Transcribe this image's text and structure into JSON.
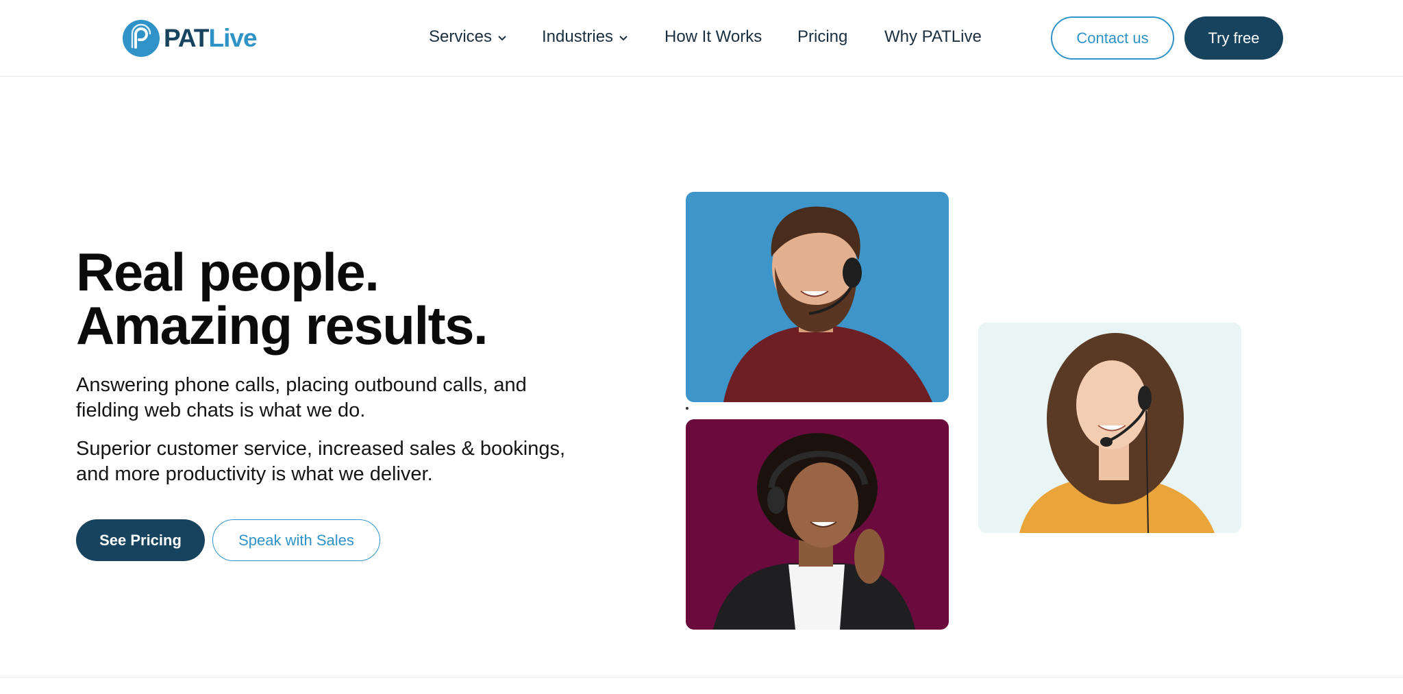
{
  "brand": {
    "logo_part1": "PAT",
    "logo_part2": "Live",
    "primary_color": "#17435e",
    "accent_color": "#2f93c8"
  },
  "nav": {
    "items": [
      {
        "label": "Services",
        "has_dropdown": true
      },
      {
        "label": "Industries",
        "has_dropdown": true
      },
      {
        "label": "How It Works",
        "has_dropdown": false
      },
      {
        "label": "Pricing",
        "has_dropdown": false
      },
      {
        "label": "Why PATLive",
        "has_dropdown": false
      }
    ],
    "contact_label": "Contact us",
    "try_label": "Try free"
  },
  "hero": {
    "title_line1": "Real people.",
    "title_line2": "Amazing results.",
    "paragraph1": "Answering phone calls, placing outbound calls, and fielding web chats is what we do.",
    "paragraph2": "Superior customer service, increased sales & bookings, and more productivity is what we deliver.",
    "primary_cta": "See Pricing",
    "secondary_cta": "Speak with Sales"
  },
  "images": {
    "tile1_color": "#3d95c9",
    "tile2_color": "#6b0b3d",
    "tile3_color": "#e9f4f5"
  }
}
